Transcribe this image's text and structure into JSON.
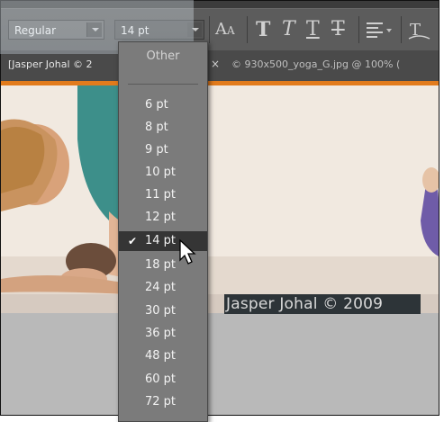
{
  "options_bar": {
    "font_style": "Regular",
    "font_size": "14 pt",
    "icons": [
      "anti-alias-icon",
      "faux-bold-icon",
      "faux-italic-icon",
      "underline-icon",
      "strikethrough-icon",
      "align-left-icon",
      "warp-text-icon"
    ]
  },
  "tabs": [
    {
      "label": "[Jasper Johal © 2"
    },
    {
      "label": "© 930x500_yoga_G.jpg @ 100% ("
    }
  ],
  "tab_close": "×",
  "canvas": {
    "caption": "Jasper Johal © 2009"
  },
  "size_menu": {
    "other": "Other",
    "items": [
      "6 pt",
      "8 pt",
      "9 pt",
      "10 pt",
      "11 pt",
      "12 pt",
      "14 pt",
      "18 pt",
      "24 pt",
      "30 pt",
      "36 pt",
      "48 pt",
      "60 pt",
      "72 pt"
    ],
    "selected": "14 pt",
    "check": "✔"
  }
}
